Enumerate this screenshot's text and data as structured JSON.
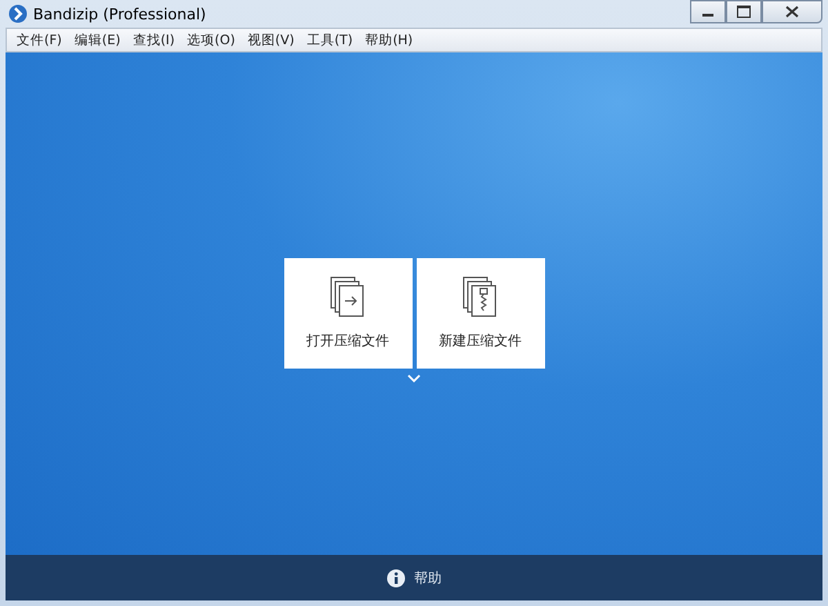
{
  "window": {
    "title": "Bandizip (Professional)"
  },
  "menu": [
    "文件(F)",
    "编辑(E)",
    "查找(I)",
    "选项(O)",
    "视图(V)",
    "工具(T)",
    "帮助(H)"
  ],
  "actions": [
    {
      "kind": "open",
      "label": "打开压缩文件"
    },
    {
      "kind": "new",
      "label": "新建压缩文件"
    }
  ],
  "footer": {
    "help": "帮助"
  }
}
